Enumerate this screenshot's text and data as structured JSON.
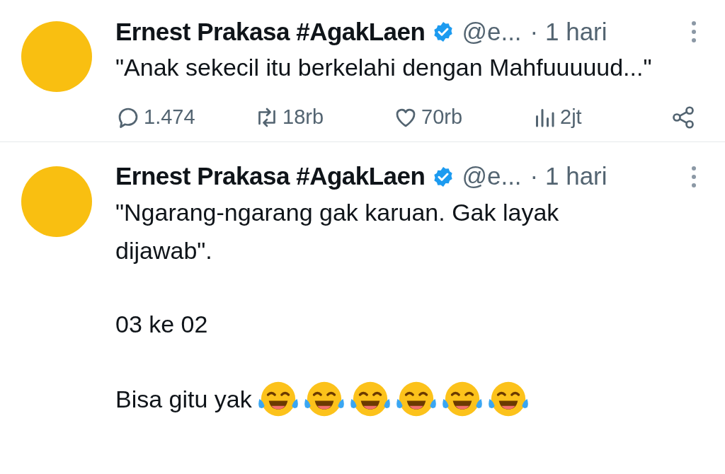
{
  "tweets": [
    {
      "name": "Ernest Prakasa #AgakLaen",
      "verified": true,
      "handle": "@e...",
      "time": "· 1 hari",
      "paragraphs": [
        {
          "text": "\"Anak sekecil itu berkelahi dengan Mahfuuuuud...\""
        }
      ],
      "actions": [
        {
          "kind": "reply",
          "count": "1.474"
        },
        {
          "kind": "repost",
          "count": "18rb"
        },
        {
          "kind": "like",
          "count": "70rb"
        },
        {
          "kind": "views",
          "count": "2jt"
        },
        {
          "kind": "share"
        }
      ]
    },
    {
      "name": "Ernest Prakasa #AgakLaen",
      "verified": true,
      "handle": "@e...",
      "time": "· 1 hari",
      "paragraphs": [
        {
          "text": "\"Ngarang-ngarang gak karuan. Gak layak dijawab\"."
        },
        {
          "text": "03 ke 02"
        },
        {
          "text": "Bisa gitu yak",
          "emojis": [
            {
              "kind": "tears-of-joy"
            },
            {
              "kind": "tears-of-joy"
            },
            {
              "kind": "tears-of-joy"
            },
            {
              "kind": "tears-of-joy"
            },
            {
              "kind": "tears-of-joy"
            },
            {
              "kind": "tears-of-joy"
            }
          ]
        }
      ]
    }
  ]
}
